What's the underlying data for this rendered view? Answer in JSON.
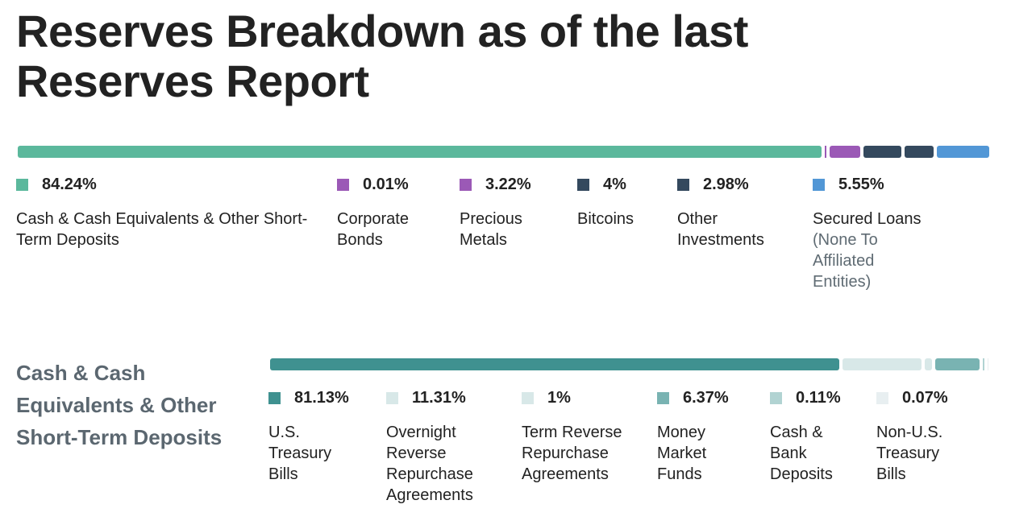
{
  "title": "Reserves Breakdown as of the last Reserves Report",
  "chart_data": [
    {
      "type": "bar",
      "orientation": "horizontal-stacked",
      "title": "Reserves Breakdown as of the last Reserves Report",
      "unit": "%",
      "series": [
        {
          "name": "Cash & Cash Equivalents & Other Short-Term Deposits",
          "value": 84.24,
          "value_label": "84.24%",
          "color": "#5bb89c"
        },
        {
          "name": "Corporate Bonds",
          "value": 0.01,
          "value_label": "0.01%",
          "color": "#9b59b6"
        },
        {
          "name": "Precious Metals",
          "value": 3.22,
          "value_label": "3.22%",
          "color": "#9b59b6"
        },
        {
          "name": "Bitcoins",
          "value": 4,
          "value_label": "4%",
          "color": "#34495e"
        },
        {
          "name": "Other Investments",
          "value": 2.98,
          "value_label": "2.98%",
          "color": "#34495e"
        },
        {
          "name": "Secured Loans",
          "note": "(None To Affiliated Entities)",
          "value": 5.55,
          "value_label": "5.55%",
          "color": "#5297d6"
        }
      ]
    },
    {
      "type": "bar",
      "orientation": "horizontal-stacked",
      "title": "Cash & Cash Equivalents & Other Short-Term Deposits",
      "unit": "%",
      "series": [
        {
          "name": "U.S. Treasury Bills",
          "value": 81.13,
          "value_label": "81.13%",
          "color": "#3f9190"
        },
        {
          "name": "Overnight Reverse Repurchase Agreements",
          "value": 11.31,
          "value_label": "11.31%",
          "color": "#d8e8e8"
        },
        {
          "name": "Term Reverse Repurchase Agreements",
          "value": 1,
          "value_label": "1%",
          "color": "#d8e8e8"
        },
        {
          "name": "Money Market Funds",
          "value": 6.37,
          "value_label": "6.37%",
          "color": "#79b3b2"
        },
        {
          "name": "Cash & Bank Deposits",
          "value": 0.11,
          "value_label": "0.11%",
          "color": "#b1d3d2"
        },
        {
          "name": "Non-U.S. Treasury Bills",
          "value": 0.07,
          "value_label": "0.07%",
          "color": "#e8eff1"
        }
      ]
    }
  ]
}
